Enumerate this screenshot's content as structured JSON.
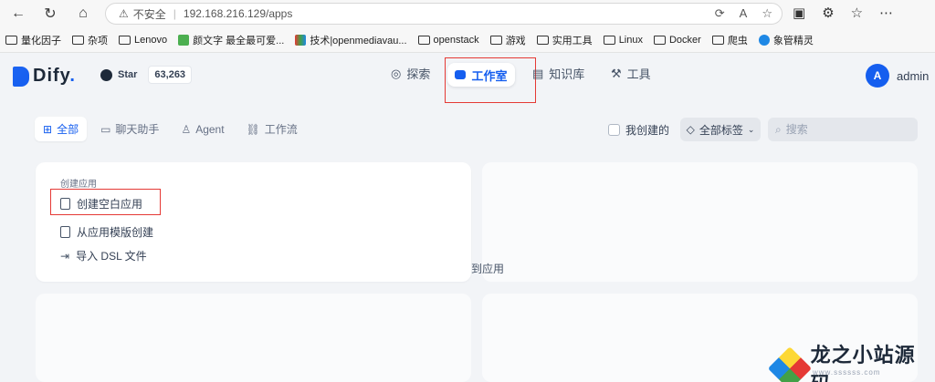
{
  "browser": {
    "security_label": "不安全",
    "url": "192.168.216.129/apps",
    "read_aloud": "Aͅ"
  },
  "bookmarks": [
    {
      "label": "量化因子",
      "icon": "folder-icon"
    },
    {
      "label": "杂项",
      "icon": "folder-icon"
    },
    {
      "label": "Lenovo",
      "icon": "folder-icon"
    },
    {
      "label": "颜文字 最全最可爱...",
      "icon": "favicon-green"
    },
    {
      "label": "技术|openmediavau...",
      "icon": "favicon-colored"
    },
    {
      "label": "openstack",
      "icon": "folder-icon"
    },
    {
      "label": "游戏",
      "icon": "folder-icon"
    },
    {
      "label": "实用工具",
      "icon": "folder-icon"
    },
    {
      "label": "Linux",
      "icon": "folder-icon"
    },
    {
      "label": "Docker",
      "icon": "folder-icon"
    },
    {
      "label": "爬虫",
      "icon": "folder-icon"
    },
    {
      "label": "象管精灵",
      "icon": "favicon-blue"
    }
  ],
  "header": {
    "logo_text": "Dify",
    "logo_suffix": ".",
    "github_label": "Star",
    "star_count": "63,263",
    "nav": {
      "explore": "探索",
      "studio": "工作室",
      "knowledge": "知识库",
      "tools": "工具"
    },
    "user_initial": "A",
    "user_name": "admin"
  },
  "filters": {
    "tabs": [
      "全部",
      "聊天助手",
      "Agent",
      "工作流"
    ],
    "active_tab": "全部",
    "created_by_me": "我创建的",
    "all_tags": "全部标签",
    "search_placeholder": "搜索"
  },
  "create_card": {
    "title": "创建应用",
    "items": [
      "创建空白应用",
      "从应用模版创建",
      "导入 DSL 文件"
    ]
  },
  "drop_hint": "到应用",
  "watermark": {
    "text": "龙之小站源码",
    "sub": "www.ssssss.com"
  },
  "colors": {
    "accent": "#155eef",
    "annotation_red": "#e53935",
    "background": "#f2f4f7"
  }
}
